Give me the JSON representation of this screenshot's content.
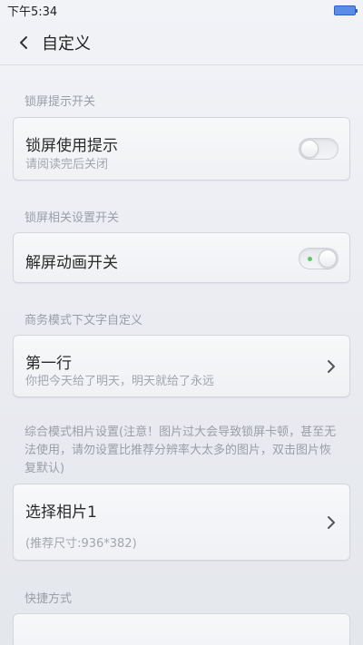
{
  "status_bar": {
    "time": "下午5:34"
  },
  "header": {
    "title": "自定义"
  },
  "sections": {
    "lock_hint": {
      "label": "锁屏提示开关",
      "item_title": "锁屏使用提示",
      "item_sub": "请阅读完后关闭",
      "toggle_state": "off"
    },
    "lock_settings": {
      "label": "锁屏相关设置开关",
      "item_title": "解屏动画开关",
      "toggle_state": "on"
    },
    "business_text": {
      "label": "商务模式下文字自定义",
      "item_title": "第一行",
      "item_sub": "你把今天给了明天，明天就给了永远"
    },
    "photo": {
      "note": "综合模式相片设置(注意！图片过大会导致锁屏卡顿，甚至无法使用，请勿设置比推荐分辨率大太多的图片，双击图片恢复默认)",
      "item_title": "选择相片1",
      "item_sub": "(推荐尺寸:936*382)"
    },
    "shortcut": {
      "label": "快捷方式"
    }
  },
  "colors": {
    "toggle_on_dot": "#5dc76a",
    "battery": "#5b8de8"
  }
}
